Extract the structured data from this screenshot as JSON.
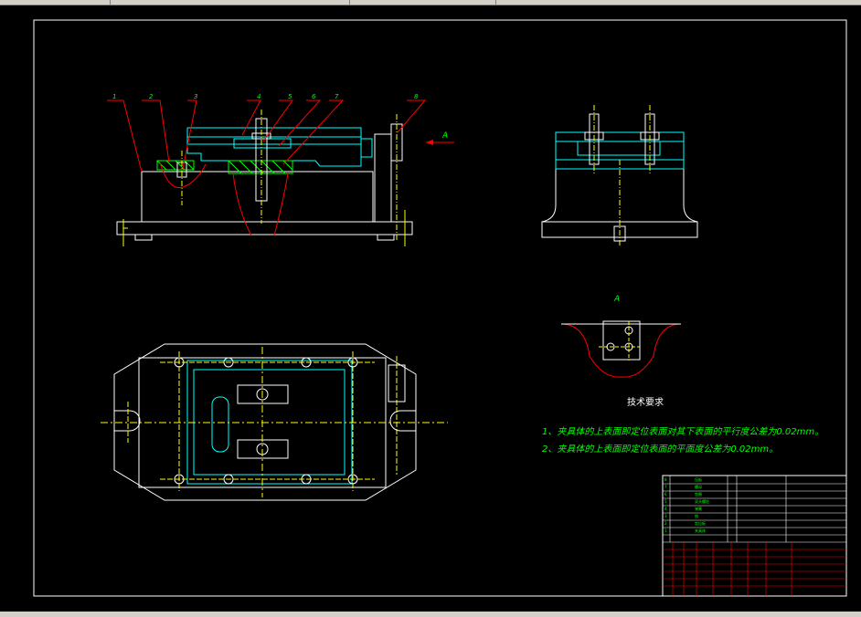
{
  "part_numbers": [
    "1",
    "2",
    "3",
    "4",
    "5",
    "6",
    "7",
    "8"
  ],
  "view_label": "A",
  "tech_req": {
    "title": "技术要求",
    "items": [
      "1、夹具体的上表面即定位表面对其下表面的平行度公差为0.02mm。",
      "2、夹具体的上表面即定位表面的平面度公差为0.02mm。"
    ]
  },
  "colors": {
    "frame": "#ffffff",
    "outline": "#ffffff",
    "part": "#00ffff",
    "center": "#ffff00",
    "leader": "#ff0000",
    "hatch": "#00ff00",
    "text": "#00ff00"
  },
  "bom_rows": [
    {
      "no": "8",
      "name": "压板"
    },
    {
      "no": "7",
      "name": "螺母"
    },
    {
      "no": "6",
      "name": "垫圈"
    },
    {
      "no": "5",
      "name": "双头螺柱"
    },
    {
      "no": "4",
      "name": "弹簧"
    },
    {
      "no": "3",
      "name": "销"
    },
    {
      "no": "2",
      "name": "定位板"
    },
    {
      "no": "1",
      "name": "夹具体"
    }
  ],
  "icons": {
    "arrow": "arrow-left-icon"
  }
}
